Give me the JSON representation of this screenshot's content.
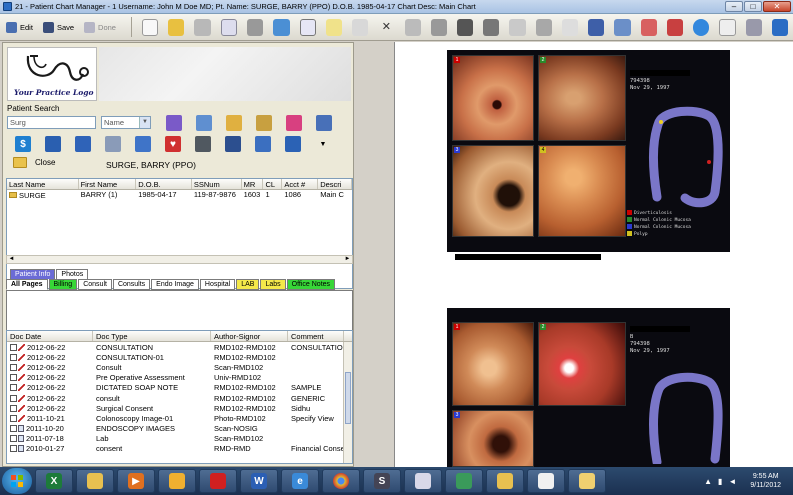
{
  "window": {
    "title": "21 - Patient Chart Manager - 1  Username: John M  Doe  MD; Pt. Name: SURGE, BARRY (PPO)  D.O.B. 1985-04-17 Chart Desc: Main Chart",
    "minimize": "–",
    "maximize": "□",
    "close": "✕"
  },
  "toolbar": {
    "edit_label": "Edit",
    "save_label": "Save",
    "done_label": "Done"
  },
  "logo": {
    "text": "Your Practice Logo"
  },
  "patient_search": {
    "label": "Patient Search",
    "input_value": "Surg",
    "field_select": "Name",
    "close_label": "Close",
    "current_patient": "SURGE, BARRY (PPO)"
  },
  "patient_grid": {
    "columns": [
      "Last Name",
      "First Name",
      "D.O.B.",
      "SSNum",
      "MR",
      "CL",
      "Acct #",
      "Descri"
    ],
    "rows": [
      [
        "SURGE",
        "BARRY (1)",
        "1985-04-17",
        "119-87-9876",
        "1603",
        "1",
        "1086",
        "Main C"
      ]
    ]
  },
  "tabs_top": [
    "Patient Info",
    "Photos"
  ],
  "tabs_doc": [
    "All Pages",
    "Billing",
    "Consult",
    "Consults",
    "Endo Image",
    "Hospital",
    "LAB",
    "Labs",
    "Office Notes"
  ],
  "doc_grid": {
    "columns": [
      "Doc Date",
      "Doc Type",
      "Author-Signor",
      "Comment"
    ],
    "rows": [
      {
        "date": "2012-06-22",
        "type": "CONSULTATION",
        "author": "RMD102-RMD102",
        "comment": "CONSULTATIO",
        "icon": "pen"
      },
      {
        "date": "2012-06-22",
        "type": "CONSULTATION-01",
        "author": "RMD102-RMD102",
        "comment": "",
        "icon": "pen"
      },
      {
        "date": "2012-06-22",
        "type": "Consult",
        "author": "Scan-RMD102",
        "comment": "",
        "icon": "pen"
      },
      {
        "date": "2012-06-22",
        "type": "Pre Operative Assessment",
        "author": "Univ-RMD102",
        "comment": "",
        "icon": "pen"
      },
      {
        "date": "2012-06-22",
        "type": "DICTATED SOAP NOTE",
        "author": "RMD102-RMD102",
        "comment": "SAMPLE",
        "icon": "pen"
      },
      {
        "date": "2012-06-22",
        "type": "consult",
        "author": "RMD102-RMD102",
        "comment": "GENERIC",
        "icon": "pen"
      },
      {
        "date": "2012-06-22",
        "type": "Surgical Consent",
        "author": "RMD102-RMD102",
        "comment": "Sidhu",
        "icon": "pen"
      },
      {
        "date": "2011-10-21",
        "type": "Colonoscopy Image-01",
        "author": "Photo-RMD102",
        "comment": "Specify View",
        "icon": "pen"
      },
      {
        "date": "2011-10-20",
        "type": "ENDOSCOPY IMAGES",
        "author": "Scan-NOSIG",
        "comment": "",
        "icon": "doc"
      },
      {
        "date": "2011-07-18",
        "type": "Lab",
        "author": "Scan-RMD102",
        "comment": "",
        "icon": "doc"
      },
      {
        "date": "2010-01-27",
        "type": "consent",
        "author": "RMD-RMD",
        "comment": "Financial Conse",
        "icon": "doc"
      }
    ]
  },
  "viewer": {
    "plate1_info": [
      "794398",
      "Nov 29, 1997"
    ],
    "plate2_info": [
      "B",
      "794398",
      "Nov 29, 1997"
    ],
    "plate1_legend": [
      "Diverticulosis",
      "Normal Colonic Mucosa",
      "Normal Colonic Mucosa",
      "Polyp"
    ]
  },
  "taskbar": {
    "time": "9:55 AM",
    "date": "9/11/2012"
  },
  "colors": {
    "accent": "#2a6cc4",
    "tab_active": "#6b6bd6",
    "tab_green": "#37d637",
    "tab_yellow": "#f4e94a"
  }
}
